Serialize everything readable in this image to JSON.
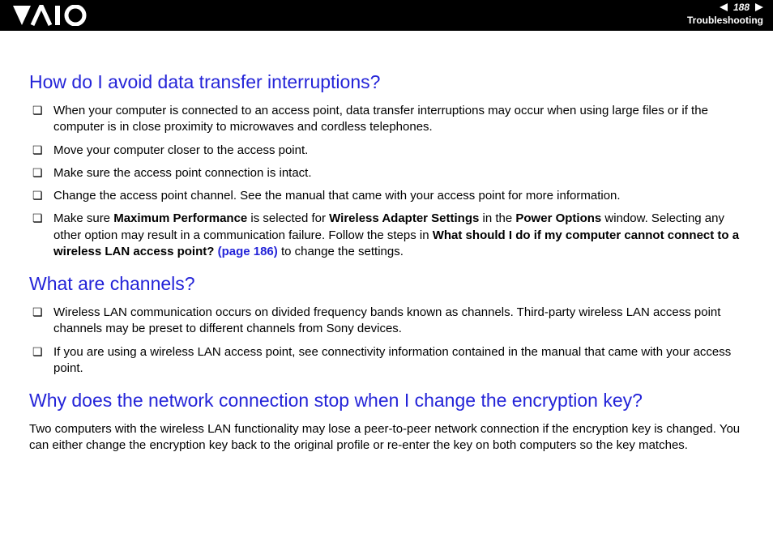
{
  "header": {
    "page_number": "188",
    "section": "Troubleshooting"
  },
  "s1": {
    "title": "How do I avoid data transfer interruptions?",
    "i0": "When your computer is connected to an access point, data transfer interruptions may occur when using large files or if the computer is in close proximity to microwaves and cordless telephones.",
    "i1": "Move your computer closer to the access point.",
    "i2": "Make sure the access point connection is intact.",
    "i3": "Change the access point channel. See the manual that came with your access point for more information.",
    "i4_a": "Make sure ",
    "i4_b1": "Maximum Performance",
    "i4_c": " is selected for ",
    "i4_b2": "Wireless Adapter Settings",
    "i4_d": " in the ",
    "i4_b3": "Power Options",
    "i4_e": " window. Selecting any other option may result in a communication failure. Follow the steps in ",
    "i4_b4": "What should I do if my computer cannot connect to a wireless LAN access point? ",
    "i4_link": "(page 186)",
    "i4_f": " to change the settings."
  },
  "s2": {
    "title": "What are channels?",
    "i0": "Wireless LAN communication occurs on divided frequency bands known as channels. Third-party wireless LAN access point channels may be preset to different channels from Sony devices.",
    "i1": "If you are using a wireless LAN access point, see connectivity information contained in the manual that came with your access point."
  },
  "s3": {
    "title": "Why does the network connection stop when I change the encryption key?",
    "p0": "Two computers with the wireless LAN functionality may lose a peer-to-peer network connection if the encryption key is changed. You can either change the encryption key back to the original profile or re-enter the key on both computers so the key matches."
  }
}
